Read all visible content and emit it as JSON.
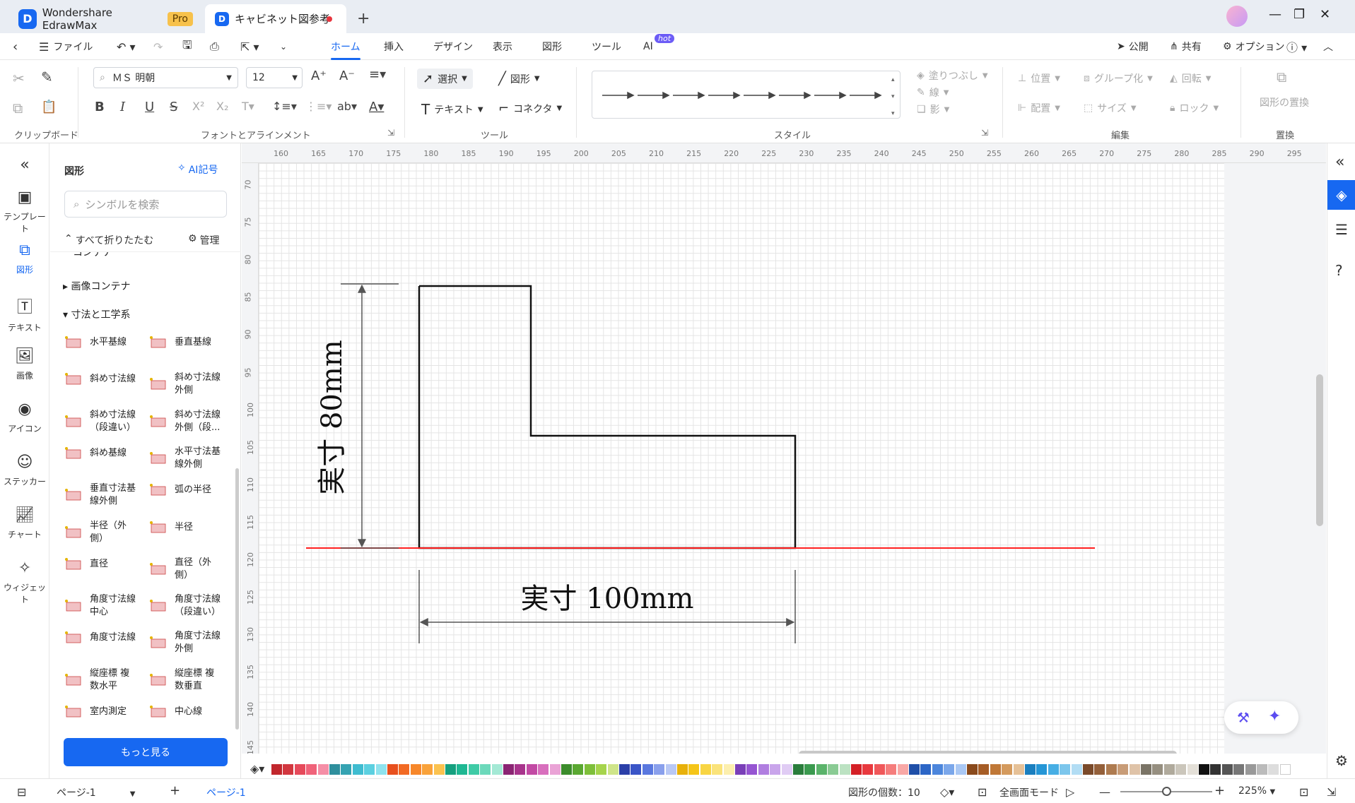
{
  "titlebar": {
    "app_tab": "Wondershare EdrawMax",
    "pro_badge": "Pro",
    "doc_tab": "キャビネット図参考",
    "new_tab": "+"
  },
  "menubar": {
    "file": "ファイル",
    "items": [
      "ホーム",
      "挿入",
      "デザイン",
      "表示",
      "図形",
      "ツール",
      "AI"
    ],
    "hot": "hot",
    "publish": "公開",
    "share": "共有",
    "options": "オプション"
  },
  "ribbon": {
    "groups": [
      "クリップボード",
      "フォントとアラインメント",
      "ツール",
      "スタイル",
      "編集",
      "置換"
    ],
    "font_name": "ＭＳ 明朝",
    "font_size": "12",
    "select": "選択",
    "shape": "図形",
    "text": "テキスト",
    "connector": "コネクタ",
    "fill": "塗りつぶし",
    "line": "線",
    "shadow": "影",
    "position": "位置",
    "group": "グループ化",
    "rotate": "回転",
    "align": "配置",
    "size": "サイズ",
    "lock": "ロック",
    "replace_shape": "図形の置換"
  },
  "leftrail": [
    "テンプレート",
    "図形",
    "テキスト",
    "画像",
    "アイコン",
    "ステッカー",
    "チャート",
    "ウィジェット"
  ],
  "panel": {
    "title": "図形",
    "ai_symbol": "AI記号",
    "search_placeholder": "シンボルを検索",
    "collapse_all": "すべて折りたたむ",
    "manage": "管理",
    "cut_category": "コンテナ",
    "categories": [
      "画像コンテナ",
      "寸法と工学系"
    ],
    "shapes": [
      [
        "水平基線",
        "垂直基線"
      ],
      [
        "斜め寸法線",
        "斜め寸法線\n外側"
      ],
      [
        "斜め寸法線\n（段違い）",
        "斜め寸法線\n外側（段..."
      ],
      [
        "斜め基線",
        "水平寸法基\n線外側"
      ],
      [
        "垂直寸法基\n線外側",
        "弧の半径"
      ],
      [
        "半径（外\n側）",
        "半径"
      ],
      [
        "直径",
        "直径（外\n側）"
      ],
      [
        "角度寸法線\n中心",
        "角度寸法線\n（段違い）"
      ],
      [
        "角度寸法線",
        "角度寸法線\n外側"
      ],
      [
        "縦座標 複\n数水平",
        "縦座標 複\n数垂直"
      ],
      [
        "室内測定",
        "中心線"
      ]
    ],
    "more_button": "もっと見る"
  },
  "ruler": {
    "h": [
      "160",
      "165",
      "170",
      "175",
      "180",
      "185",
      "190",
      "195",
      "200",
      "205",
      "210",
      "215",
      "220",
      "225",
      "230",
      "235",
      "240",
      "245",
      "250",
      "255",
      "260",
      "265",
      "270",
      "275",
      "280",
      "285",
      "290",
      "295"
    ],
    "v": [
      "70",
      "75",
      "80",
      "85",
      "90",
      "95",
      "100",
      "105",
      "110",
      "115",
      "120",
      "125",
      "130",
      "135",
      "140",
      "145"
    ]
  },
  "drawing": {
    "vertical_dim": "実寸 80mm",
    "horizontal_dim": "実寸 100mm",
    "accent_red": "#ff2020"
  },
  "status": {
    "page_select": "ページ-1",
    "page_tab": "ページ-1",
    "shape_count": "図形の個数：10",
    "fullscreen": "全画面モード",
    "zoom": "225%"
  },
  "palette": [
    "#c1272d",
    "#d2373f",
    "#e64a5b",
    "#f0637a",
    "#f58fa7",
    "#2f8f9d",
    "#35a3b2",
    "#3fbcd0",
    "#5cd0e0",
    "#8fe3ee",
    "#e8501e",
    "#f26a24",
    "#f7872a",
    "#f9a23a",
    "#fbc24f",
    "#15a07f",
    "#1fb893",
    "#3fcba6",
    "#6cd9bb",
    "#a4e9d5",
    "#8b2473",
    "#a8348c",
    "#c24aa4",
    "#d86fbd",
    "#eaa3d6",
    "#3c8c2c",
    "#5aa832",
    "#7ebf3a",
    "#a6d44c",
    "#cfe58a",
    "#2b3fa8",
    "#3a55c7",
    "#5a78df",
    "#8aa0ec",
    "#b9c8f5",
    "#e8b10a",
    "#f5c518",
    "#f8d543",
    "#fae37a",
    "#fcefae",
    "#7a3fb8",
    "#9655d2",
    "#b07ee0",
    "#c9a5eb",
    "#e0ccf4",
    "#2a7d3c",
    "#3b9a4f",
    "#5bb46b",
    "#8acb94",
    "#bce2c2",
    "#d42026",
    "#e8393e",
    "#f0585a",
    "#f57d7c",
    "#f9a8a6",
    "#1f4fa8",
    "#2c66c6",
    "#4c86dc",
    "#7ba7ea",
    "#aac8f4",
    "#8a4a1c",
    "#a65d26",
    "#c07837",
    "#d49a5d",
    "#e6c197",
    "#1a7fbf",
    "#2596d6",
    "#47aee4",
    "#7cc6ec",
    "#b2ddf4",
    "#7a4a2a",
    "#94603a",
    "#ae7b50",
    "#c89c77",
    "#dfc3a8",
    "#7a7466",
    "#968f80",
    "#b0aa9c",
    "#cbc6bb",
    "#e4e0d8",
    "#111111",
    "#333333",
    "#555555",
    "#777777",
    "#999999",
    "#bbbbbb",
    "#dddddd",
    "#ffffff"
  ]
}
